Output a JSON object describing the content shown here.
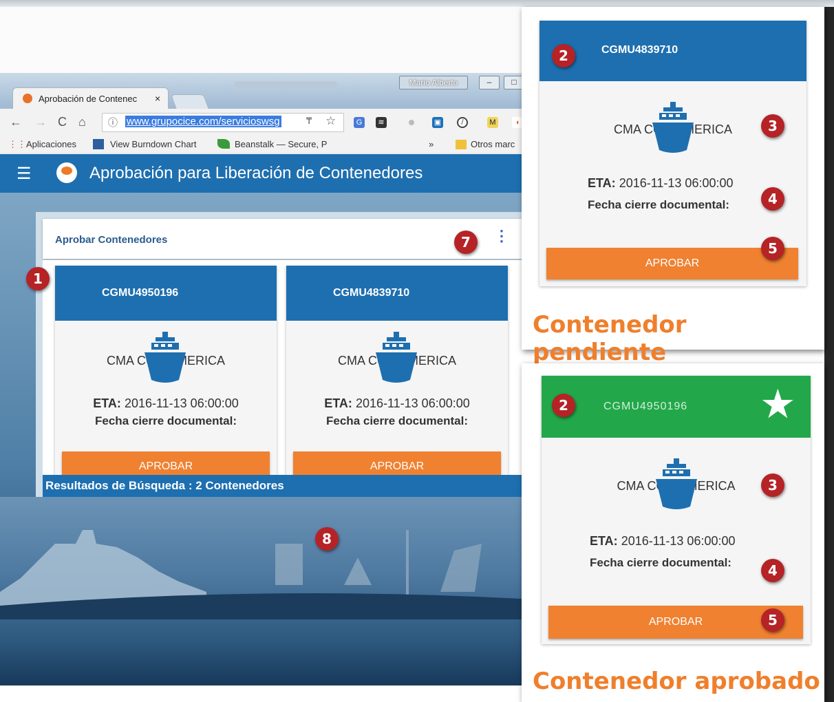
{
  "browser": {
    "tab_title": "Aprobación de Contenec",
    "tab_close": "×",
    "window_user": "Mario Alberto",
    "url": "www.grupocice.com/servicioswsg",
    "bookmarks": [
      "Aplicaciones",
      "View Burndown Chart",
      "Beanstalk — Secure, P",
      "»",
      "Otros marc"
    ]
  },
  "app": {
    "title": "Aprobación para Liberación de Contenedores",
    "section_title": "Aprobar Contenedores",
    "results_text": "Resultados de Búsqueda : 2 Contenedores"
  },
  "cards": [
    {
      "id": "CGMU4950196",
      "carrier": "CMA CGM AMERICA",
      "eta_label": "ETA:",
      "eta_value": "2016-11-13 06:00:00",
      "fecha_label": "Fecha cierre documental:",
      "button": "APROBAR"
    },
    {
      "id": "CGMU4839710",
      "carrier": "CMA CGM AMERICA",
      "eta_label": "ETA:",
      "eta_value": "2016-11-13 06:00:00",
      "fecha_label": "Fecha cierre documental:",
      "button": "APROBAR"
    }
  ],
  "pending": {
    "id": "CGMU4839710",
    "carrier": "CMA CGM AMERICA",
    "eta_label": "ETA:",
    "eta_value": "2016-11-13 06:00:00",
    "fecha_label": "Fecha cierre documental:",
    "button": "APROBAR",
    "caption": "Contenedor pendiente",
    "header_color": "#1e6fb0"
  },
  "approved": {
    "id": "CGMU4950196",
    "carrier": "CMA CGM AMERICA",
    "eta_label": "ETA:",
    "eta_value": "2016-11-13 06:00:00",
    "fecha_label": "Fecha cierre documental:",
    "button": "APROBAR",
    "caption": "Contenedor aprobado",
    "header_color": "#22a84a",
    "icon": "star-icon"
  },
  "badges": [
    "1",
    "2",
    "3",
    "4",
    "5",
    "7",
    "8"
  ],
  "colors": {
    "primary": "#1e6fb0",
    "accent": "#ef8130",
    "badge": "#b52326",
    "approved": "#22a84a",
    "caption": "#ef7f2c"
  }
}
